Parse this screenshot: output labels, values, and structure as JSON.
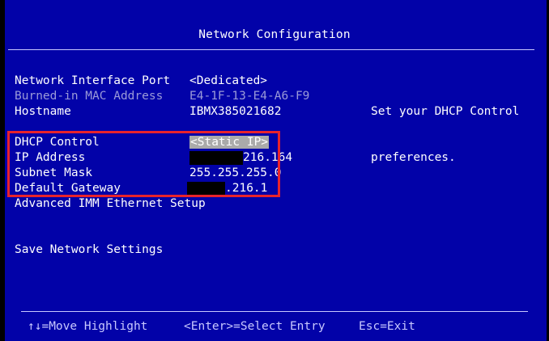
{
  "title": "Network Configuration",
  "fields": [
    {
      "label": "Network Interface Port",
      "value": "<Dedicated>"
    },
    {
      "label": "Burned-in MAC Address",
      "value": "E4-1F-13-E4-A6-F9"
    },
    {
      "label": "Hostname",
      "value": "IBMX385021682"
    },
    {
      "label": "DHCP Control",
      "value": "<Static IP>"
    },
    {
      "label": "IP Address",
      "value_suffix": "216.164"
    },
    {
      "label": "Subnet Mask",
      "value": "255.255.255.0"
    },
    {
      "label": "Default Gateway",
      "value_suffix": ".216.1"
    },
    {
      "label": "Advanced IMM Ethernet Setup"
    },
    {
      "label": "Save Network Settings"
    }
  ],
  "help": {
    "line1": "Set your DHCP Control",
    "line2": "preferences."
  },
  "footer": {
    "move": "↑↓=Move Highlight",
    "select": "<Enter>=Select Entry",
    "exit": "Esc=Exit"
  },
  "colors": {
    "background": "#0202a8",
    "text": "#ffffff",
    "dimmed_text": "#9a9ad8",
    "selection": "#aaaaaa",
    "annotation_box": "#e8232c",
    "redaction": "#000000"
  }
}
